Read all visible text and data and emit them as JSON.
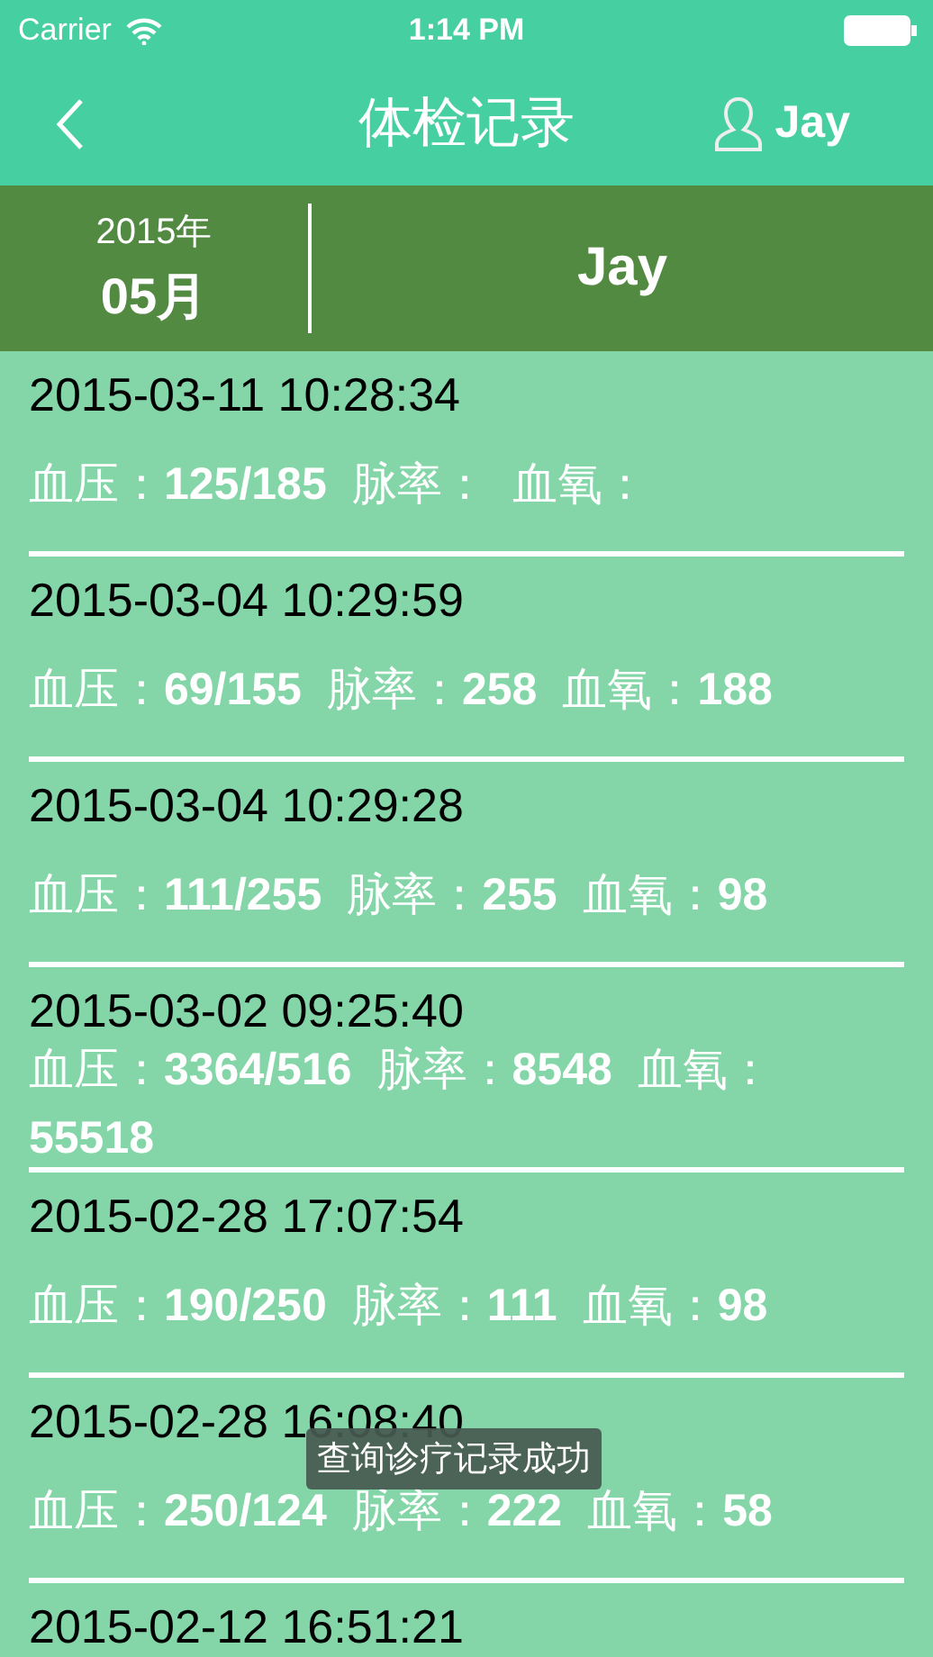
{
  "status_bar": {
    "carrier": "Carrier",
    "time": "1:14 PM"
  },
  "nav_bar": {
    "title": "体检记录",
    "user": "Jay"
  },
  "period": {
    "year": "2015年",
    "month": "05月",
    "name": "Jay"
  },
  "records": [
    {
      "datetime": "2015-03-11 10:28:34",
      "readings": [
        "血压：**125/185**",
        "脉率：",
        "血氧："
      ]
    },
    {
      "datetime": "2015-03-04 10:29:59",
      "readings": [
        "血压：**69/155**",
        "脉率：**258**",
        "血氧：**188**"
      ]
    },
    {
      "datetime": "2015-03-04 10:29:28",
      "readings": [
        "血压：**111/255**",
        "脉率：**255**",
        "血氧：**98**"
      ]
    },
    {
      "datetime": "2015-03-02 09:25:40",
      "readings": [
        "血压：**3364/516**",
        "脉率：**8548**",
        "血氧：**55518**"
      ]
    },
    {
      "datetime": "2015-02-28 17:07:54",
      "readings": [
        "血压：**190/250**",
        "脉率：**111**",
        "血氧：**98**"
      ]
    },
    {
      "datetime": "2015-02-28 16:08:40",
      "readings": [
        "血压：**250/124**",
        "脉率：**222**",
        "血氧：**58**"
      ]
    },
    {
      "datetime": "2015-02-12 16:51:21"
    }
  ],
  "toast": "查询诊疗记录成功"
}
